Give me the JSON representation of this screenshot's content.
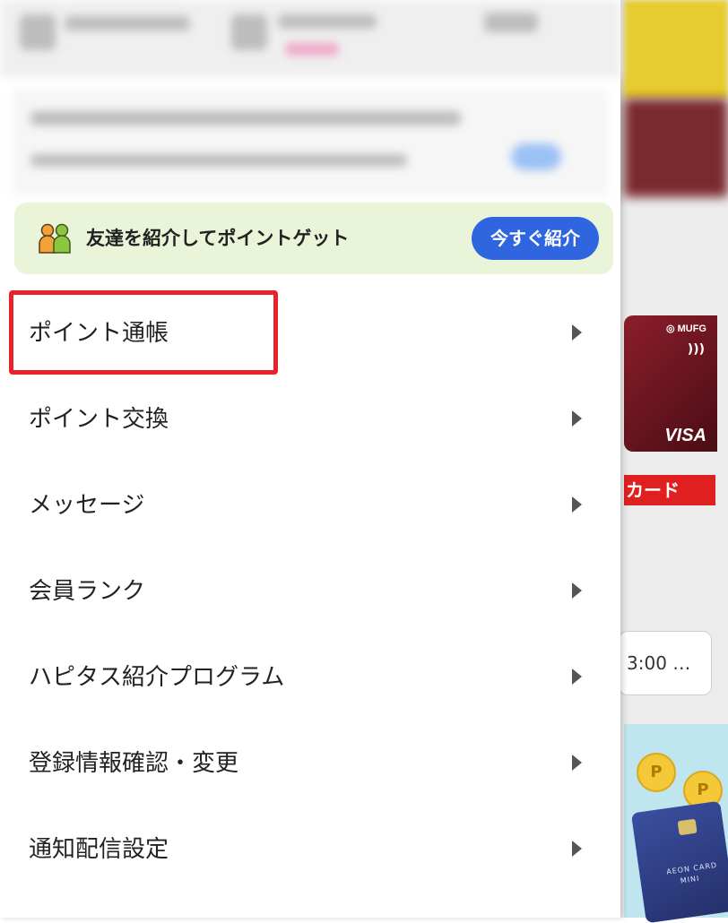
{
  "background": {
    "card_brand_top": "◎ MUFG",
    "card_contactless": ")))",
    "card_brand": "VISA",
    "card_label": "カード",
    "time_text": "3:00 …",
    "coin_symbol": "P",
    "aeon_card_text": "AEON CARD",
    "aeon_card_subtext": "MINI"
  },
  "referral": {
    "icon": "two-people-icon",
    "text": "友達を紹介してポイントゲット",
    "button_label": "今すぐ紹介",
    "button_color": "#2f66e0",
    "banner_color": "#e9f4d8"
  },
  "menu": {
    "items": [
      {
        "label": "ポイント通帳",
        "highlighted": true
      },
      {
        "label": "ポイント交換"
      },
      {
        "label": "メッセージ"
      },
      {
        "label": "会員ランク"
      },
      {
        "label": "ハピタス紹介プログラム"
      },
      {
        "label": "登録情報確認・変更"
      },
      {
        "label": "通知配信設定"
      }
    ],
    "chevron_icon": "chevron-right-icon",
    "highlight_color": "#e8222a"
  }
}
